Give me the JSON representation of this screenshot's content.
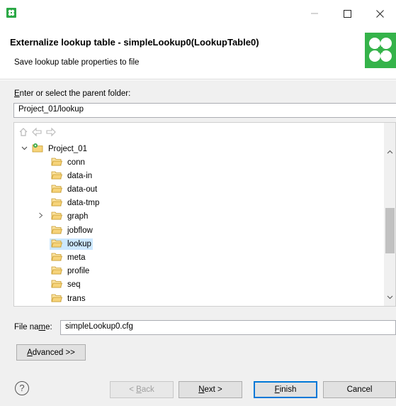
{
  "window": {
    "app_icon": "clover-app-icon",
    "minimize": "—",
    "maximize": "☐",
    "close": "✕"
  },
  "header": {
    "title": "Externalize lookup table - simpleLookup0(LookupTable0)",
    "description": "Save lookup table properties to file",
    "logo": "clover-logo"
  },
  "folder": {
    "label_prefix": "E",
    "label_rest": "nter or select the parent folder:",
    "value": "Project_01/lookup"
  },
  "tree": {
    "toolbar_icons": [
      "home-icon",
      "back-icon",
      "forward-icon"
    ],
    "root": "Project_01",
    "items": [
      {
        "label": "conn",
        "twisty": "",
        "selected": false
      },
      {
        "label": "data-in",
        "twisty": "",
        "selected": false
      },
      {
        "label": "data-out",
        "twisty": "",
        "selected": false
      },
      {
        "label": "data-tmp",
        "twisty": "",
        "selected": false
      },
      {
        "label": "graph",
        "twisty": "›",
        "selected": false
      },
      {
        "label": "jobflow",
        "twisty": "",
        "selected": false
      },
      {
        "label": "lookup",
        "twisty": "",
        "selected": true
      },
      {
        "label": "meta",
        "twisty": "",
        "selected": false
      },
      {
        "label": "profile",
        "twisty": "",
        "selected": false
      },
      {
        "label": "seq",
        "twisty": "",
        "selected": false
      },
      {
        "label": "trans",
        "twisty": "",
        "selected": false
      }
    ]
  },
  "file_name": {
    "label_a": "File na",
    "label_u": "m",
    "label_b": "e:",
    "value": "simpleLookup0.cfg"
  },
  "advanced_button": {
    "u": "A",
    "rest": "dvanced >>"
  },
  "footer": {
    "help": "?",
    "back": {
      "prefix": "< ",
      "u": "B",
      "rest": "ack"
    },
    "next": {
      "u": "N",
      "rest": "ext >"
    },
    "finish": {
      "u": "F",
      "rest": "inish"
    },
    "cancel": "Cancel"
  }
}
